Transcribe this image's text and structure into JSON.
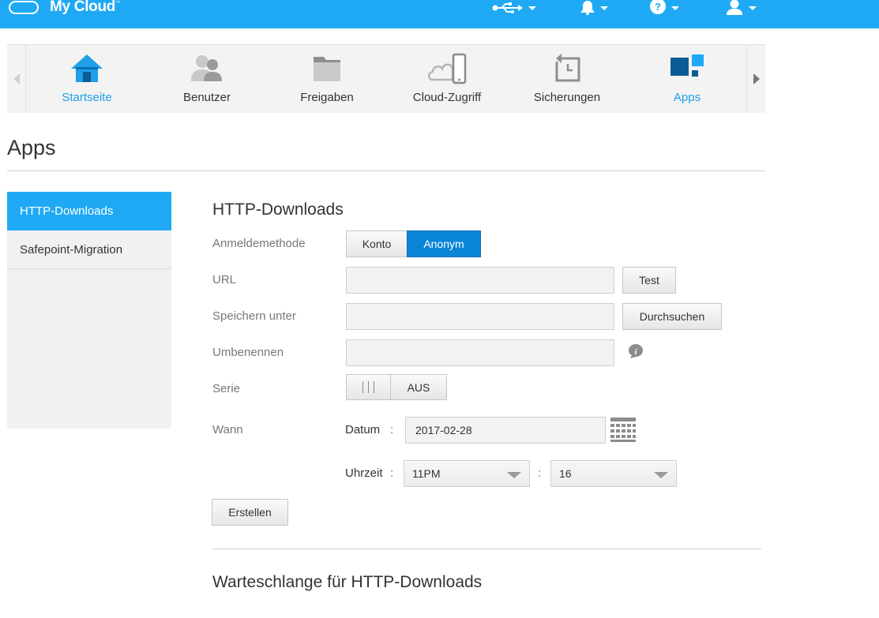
{
  "app": {
    "title": "My Cloud",
    "trademark": "™"
  },
  "topbar": {
    "icons": [
      "usb-icon",
      "bell-icon",
      "help-icon",
      "user-icon"
    ]
  },
  "nav": {
    "items": [
      {
        "label": "Startseite",
        "icon": "home-icon",
        "active": true
      },
      {
        "label": "Benutzer",
        "icon": "users-icon",
        "active": false
      },
      {
        "label": "Freigaben",
        "icon": "folder-icon",
        "active": false
      },
      {
        "label": "Cloud-Zugriff",
        "icon": "cloud-device-icon",
        "active": false
      },
      {
        "label": "Sicherungen",
        "icon": "backup-icon",
        "active": false
      },
      {
        "label": "Apps",
        "icon": "apps-icon",
        "active": true
      }
    ]
  },
  "page": {
    "title": "Apps"
  },
  "sidebar": {
    "items": [
      {
        "label": "HTTP-Downloads",
        "active": true
      },
      {
        "label": "Safepoint-Migration",
        "active": false
      }
    ]
  },
  "form": {
    "title": "HTTP-Downloads",
    "login_method": {
      "label": "Anmeldemethode",
      "options": [
        "Konto",
        "Anonym"
      ],
      "selected": "Anonym"
    },
    "url": {
      "label": "URL",
      "value": "",
      "button": "Test"
    },
    "save_to": {
      "label": "Speichern unter",
      "value": "",
      "button": "Durchsuchen"
    },
    "rename": {
      "label": "Umbenennen",
      "value": ""
    },
    "series": {
      "label": "Serie",
      "state": "AUS"
    },
    "when": {
      "label": "Wann",
      "date_label": "Datum",
      "date_value": "2017-02-28",
      "time_label": "Uhrzeit",
      "hour_value": "11PM",
      "minute_value": "16",
      "separator": ":"
    },
    "create_button": "Erstellen"
  },
  "queue": {
    "title": "Warteschlange für HTTP-Downloads"
  },
  "colors": {
    "brand": "#1fa9f4",
    "primary_button": "#0a85d6"
  }
}
